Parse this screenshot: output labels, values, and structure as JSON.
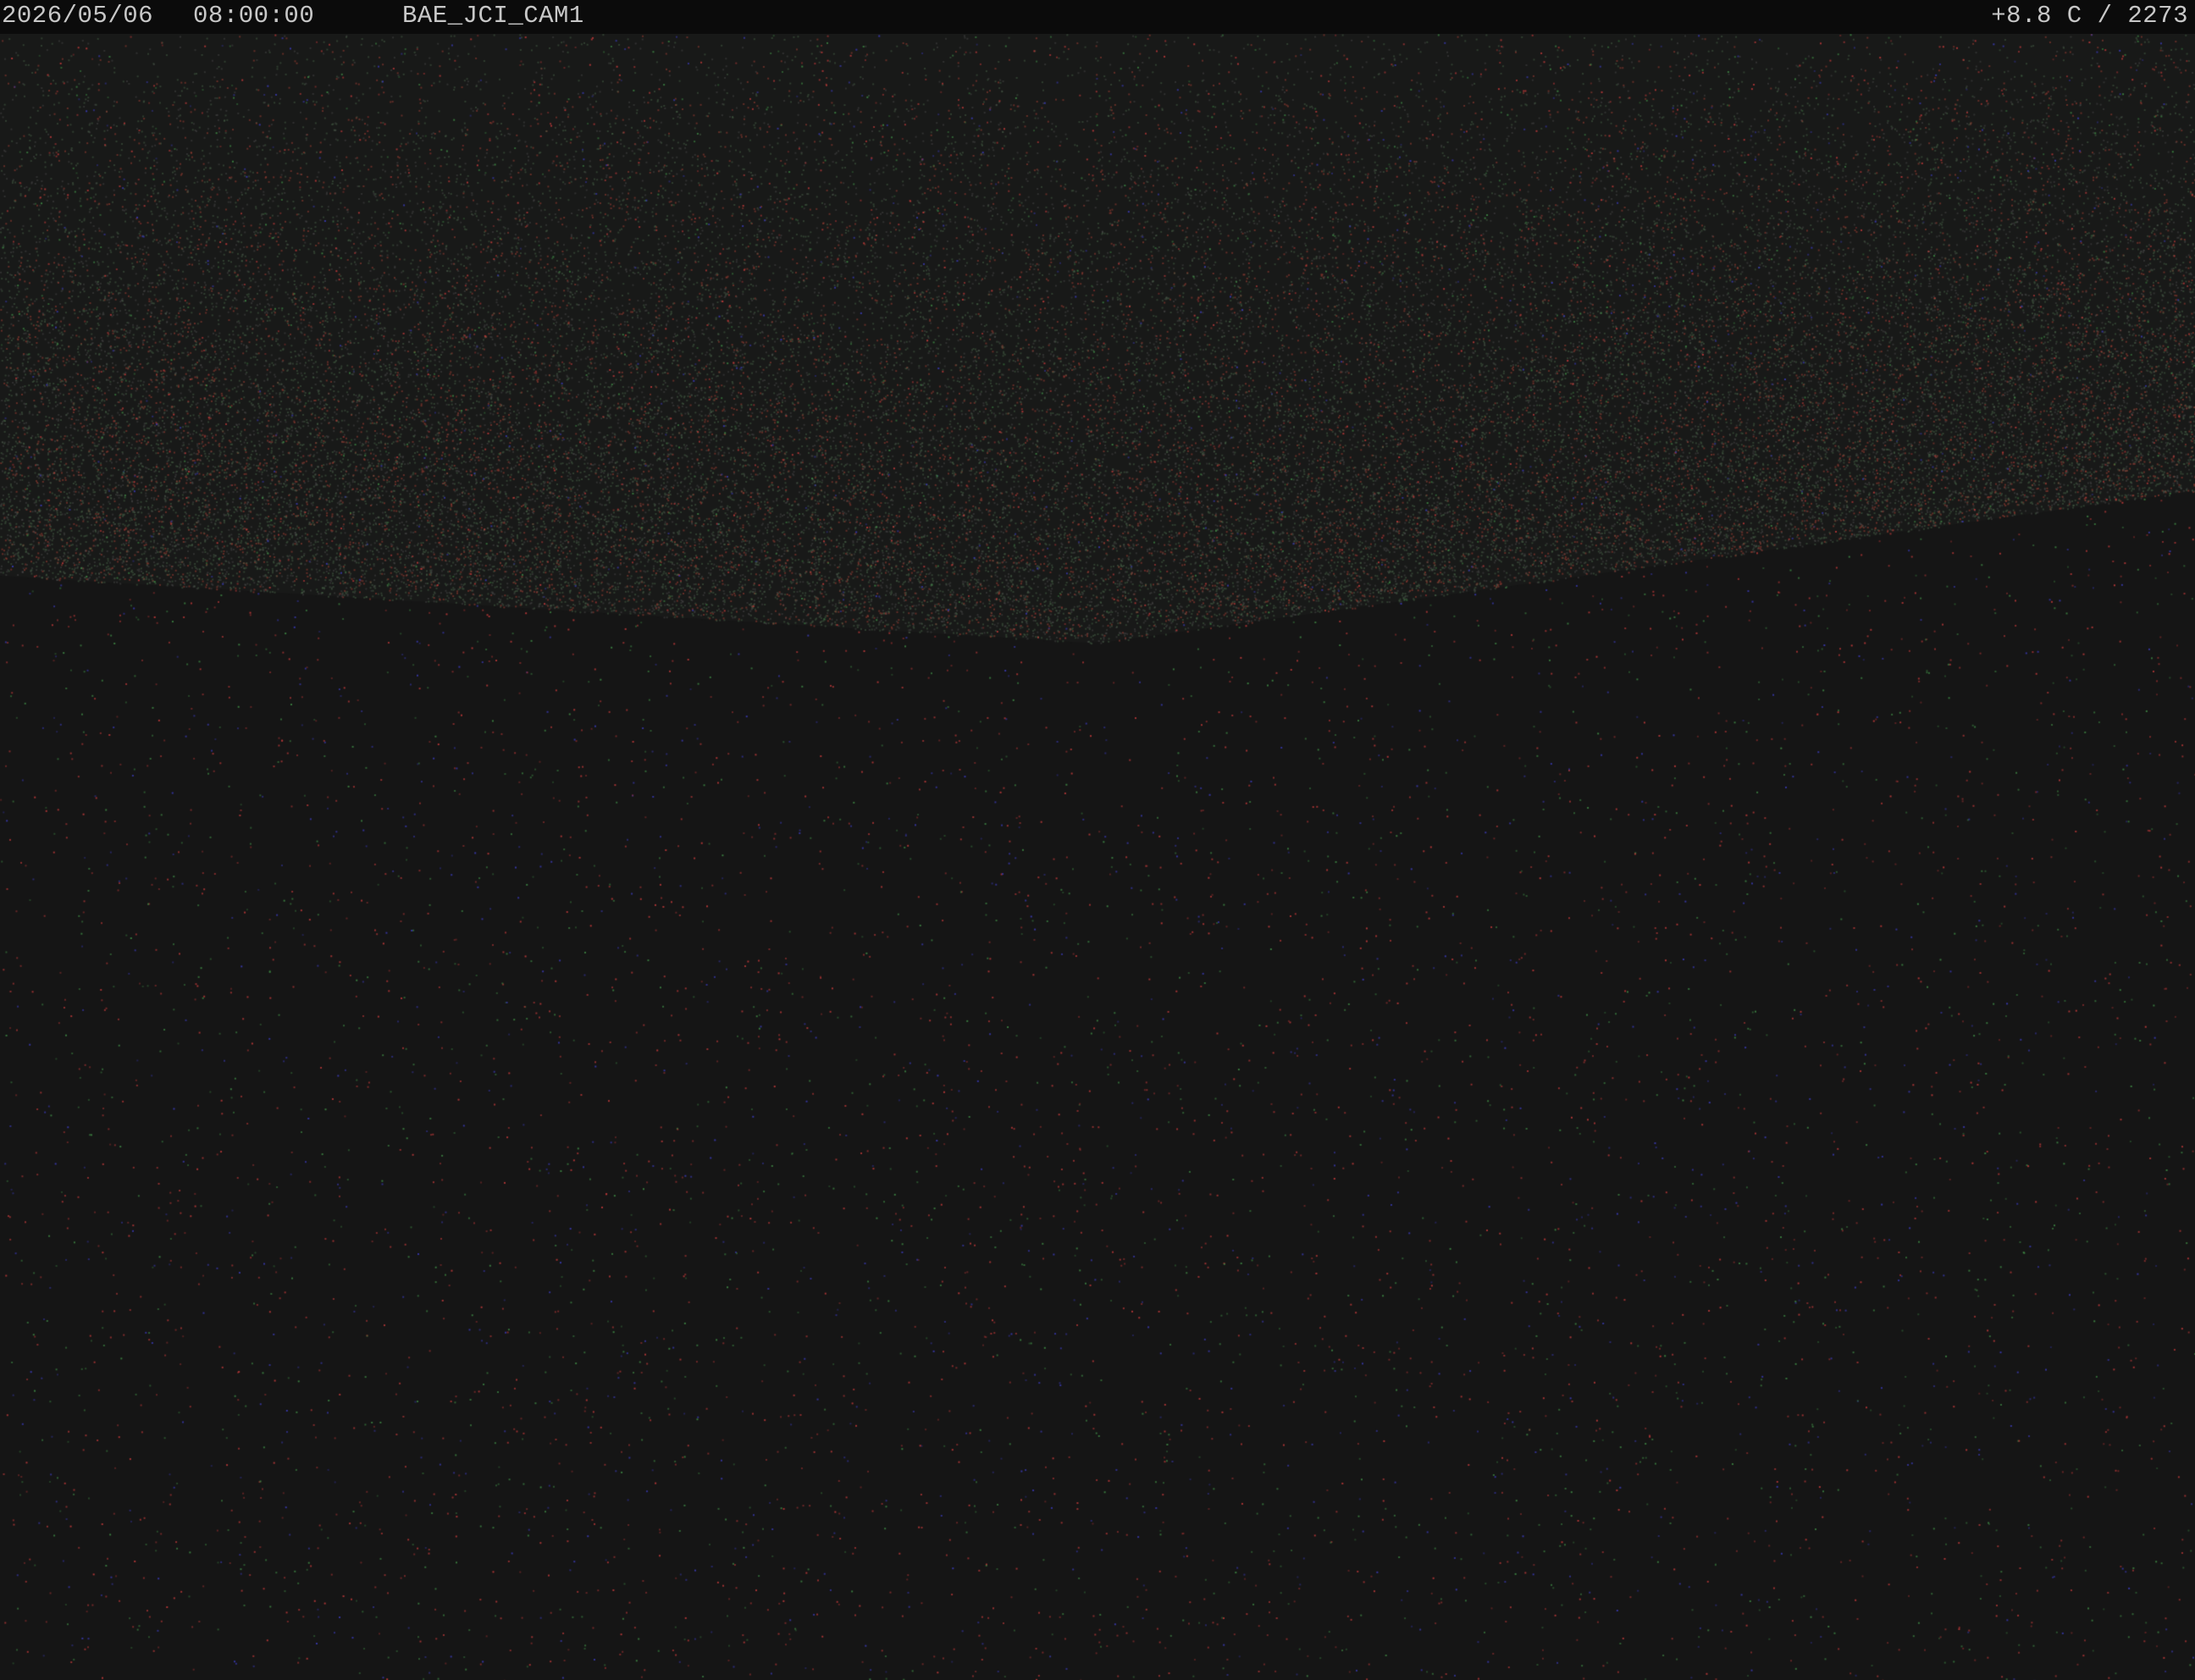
{
  "overlay": {
    "date": "2026/05/06",
    "time": "08:00:00",
    "camera_name": "BAE_JCI_CAM1",
    "temperature_reading": "+8.8 C / 2273"
  },
  "scene": {
    "description_colors": {
      "sky": "#151515",
      "noise_red": "#c23a3a",
      "noise_green": "#3f8a45",
      "noise_blue": "#3b3bb8",
      "haze_band": "#1e201e"
    }
  }
}
